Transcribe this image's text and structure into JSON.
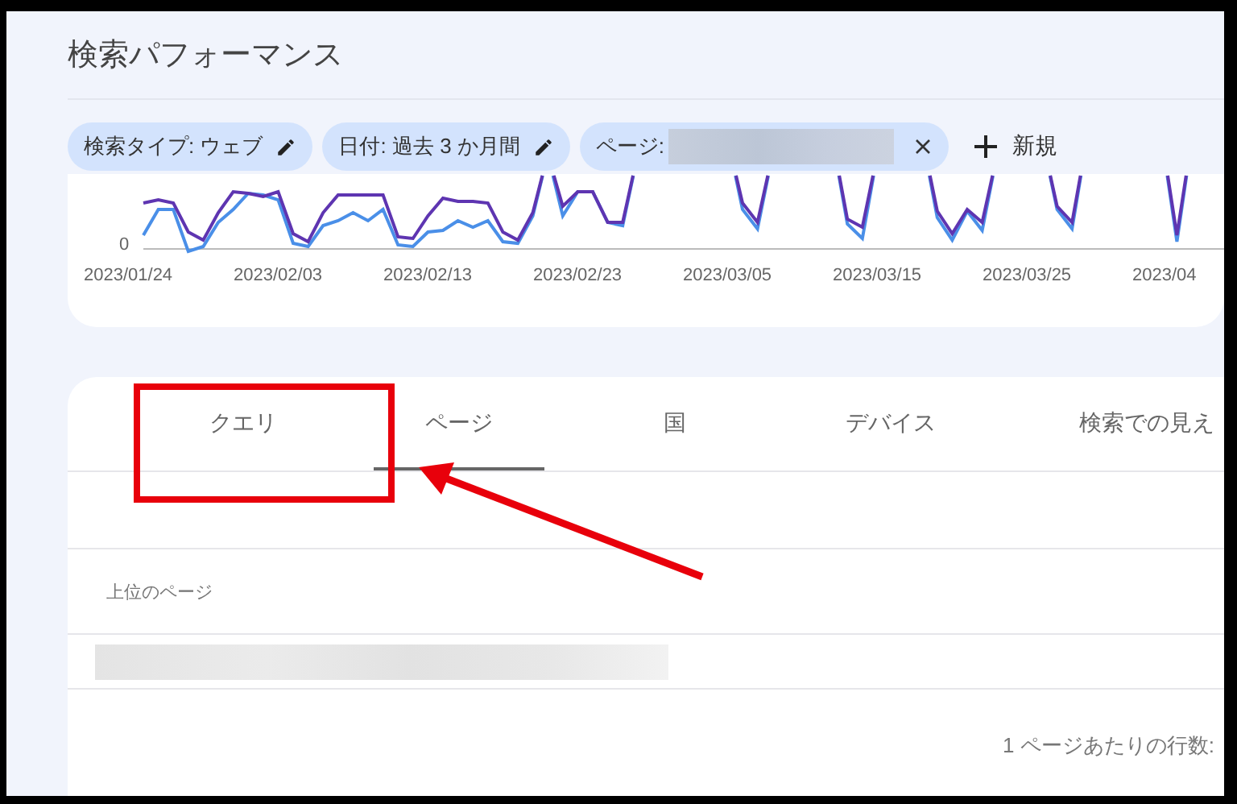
{
  "title": "検索パフォーマンス",
  "filters": [
    {
      "kind": "edit",
      "label": "検索タイプ: ウェブ"
    },
    {
      "kind": "edit",
      "label": "日付: 過去 3 か月間"
    },
    {
      "kind": "removable",
      "label": "ページ:"
    }
  ],
  "new_filter_label": "新規",
  "chart": {
    "y_tick": "0",
    "x_labels": [
      "2023/01/24",
      "2023/02/03",
      "2023/02/13",
      "2023/02/23",
      "2023/03/05",
      "2023/03/15",
      "2023/03/25",
      "2023/04"
    ]
  },
  "tabs": [
    {
      "label": "クエリ",
      "selected": false
    },
    {
      "label": "ページ",
      "selected": true
    },
    {
      "label": "国",
      "selected": false
    },
    {
      "label": "デバイス",
      "selected": false
    },
    {
      "label": "検索での見え",
      "selected": false
    }
  ],
  "table": {
    "column_header": "上位のページ",
    "rows": [
      {
        "kind": "redacted"
      }
    ]
  },
  "rows_per_page_label": "1 ページあたりの行数:",
  "annotation": {
    "highlight": true,
    "arrow": true
  }
}
